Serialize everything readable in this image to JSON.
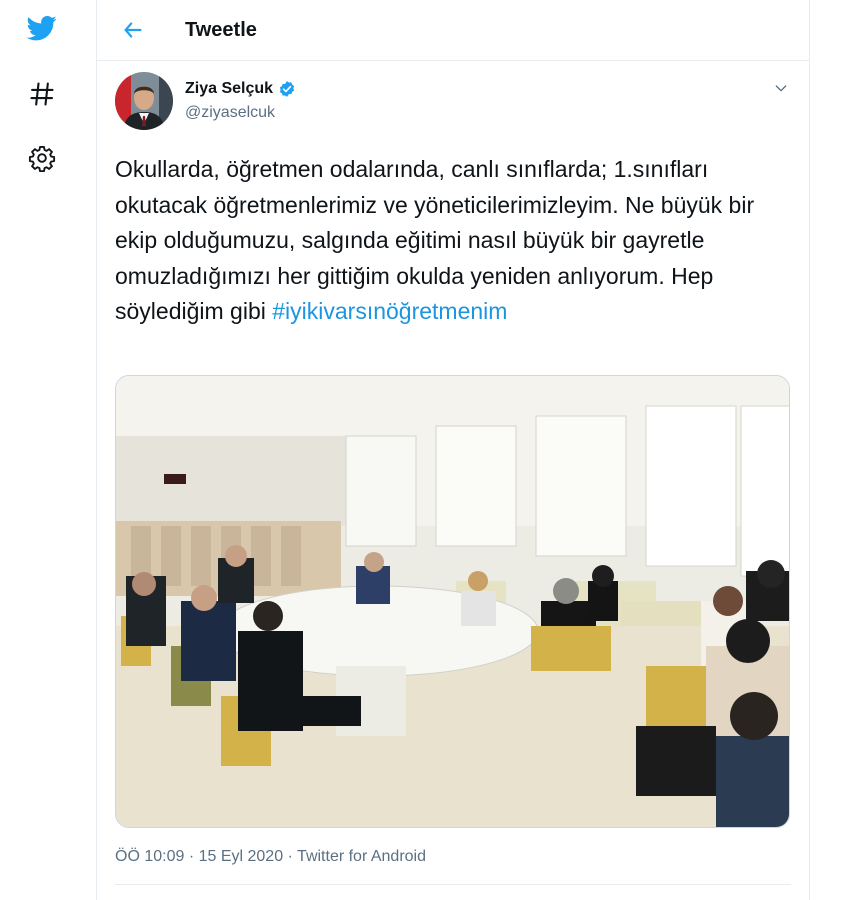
{
  "header": {
    "title": "Tweetle"
  },
  "tweet": {
    "author_name": "Ziya Selçuk",
    "author_handle": "@ziyaselcuk",
    "text_main": "Okullarda, öğretmen odalarında, canlı sınıflarda; 1.sınıfları okutacak öğretmenlerimiz ve yöneticilerimizleyim. Ne büyük bir ekip olduğumuzu, salgında eğitimi nasıl büyük bir gayretle omuzladığımızı her gittiğim okulda yeniden anlıyorum. Hep söylediğim gibi ",
    "hashtag": "#iyikivarsınöğretmenim",
    "time": "ÖÖ 10:09",
    "date": "15 Eyl 2020",
    "source": "Twitter for Android",
    "separator": " · "
  },
  "icons": {
    "rail": [
      "twitter-bird-icon",
      "hashtag-icon",
      "gear-icon"
    ],
    "header": [
      "back-arrow-icon"
    ],
    "tweet": [
      "verified-badge-icon",
      "chevron-down-icon"
    ]
  },
  "colors": {
    "accent": "#1da1f2",
    "link": "#1b95e0",
    "muted": "#5b7083",
    "border": "#e6ecf0"
  }
}
